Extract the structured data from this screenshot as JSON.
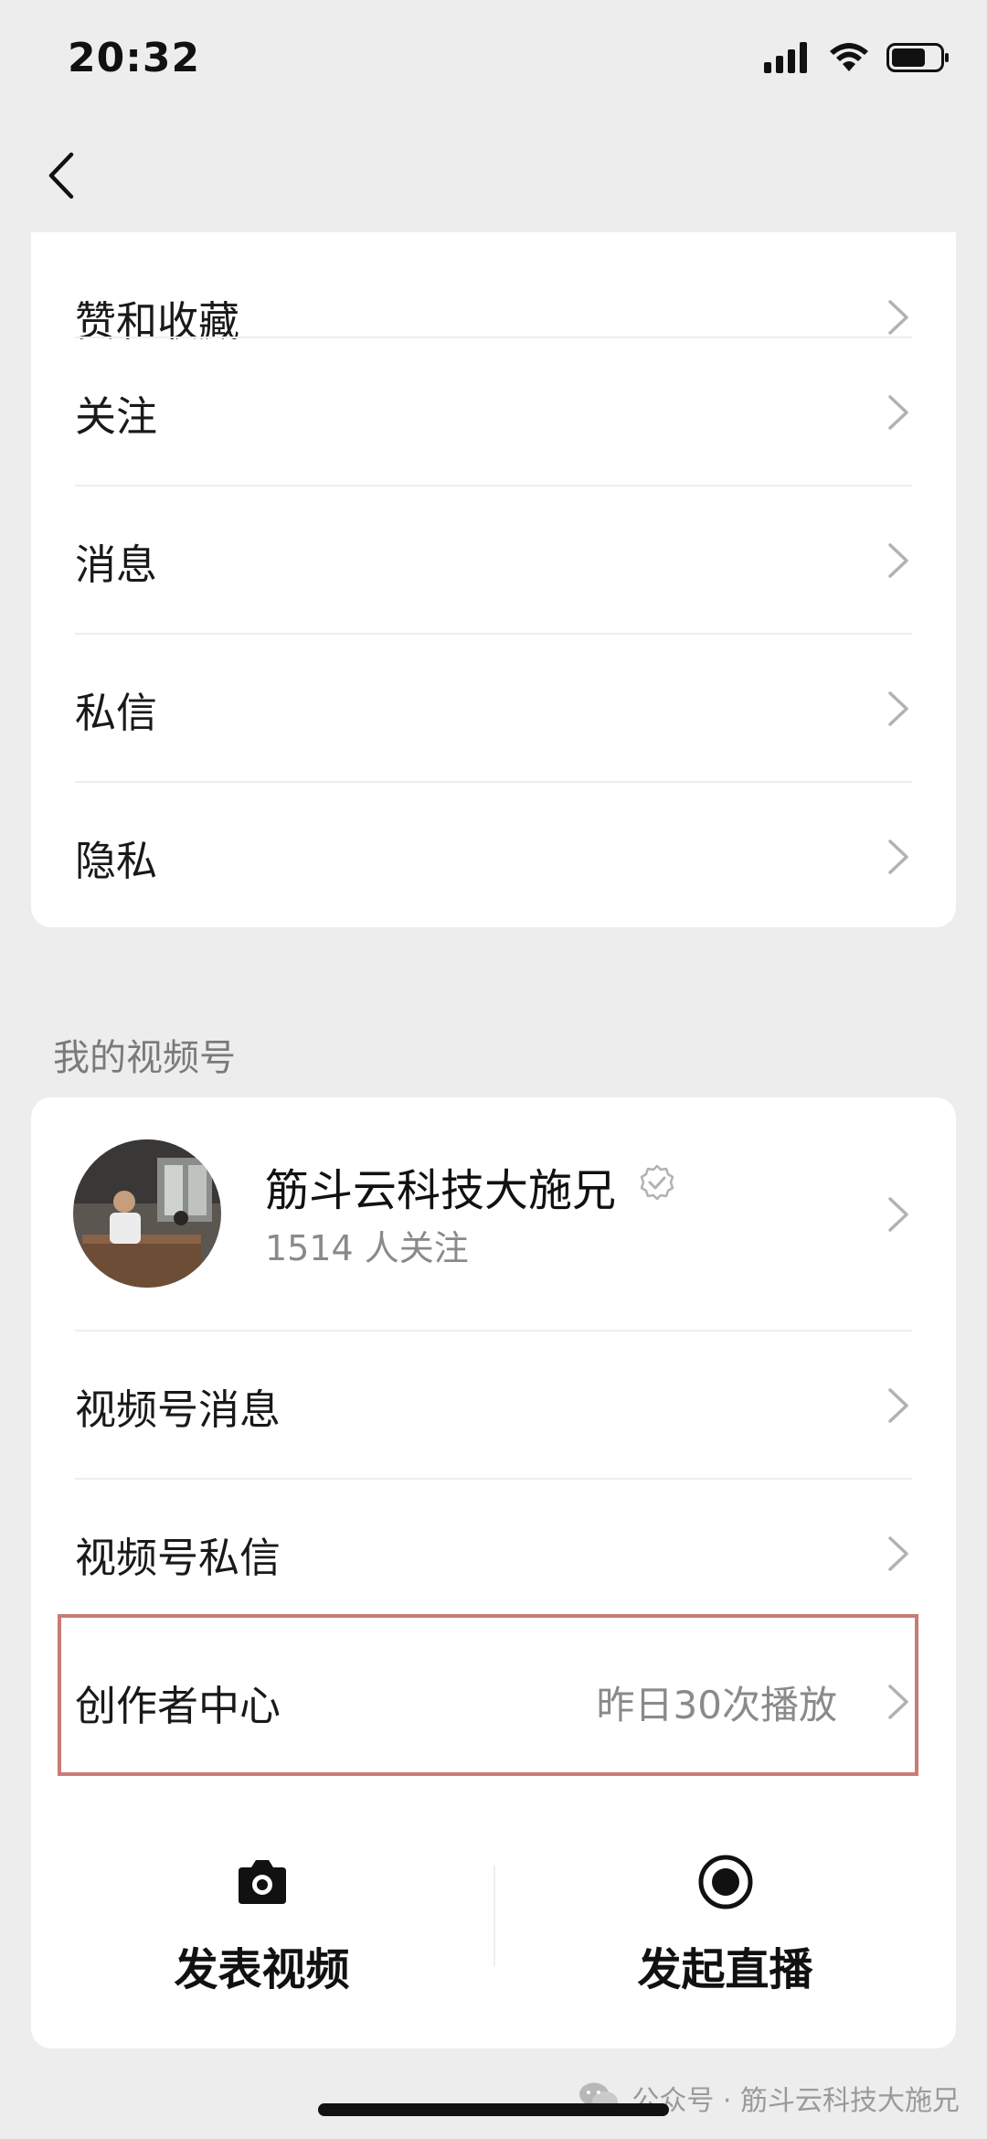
{
  "status_bar": {
    "time": "20:32",
    "battery_level": 0.7
  },
  "settings": {
    "items": [
      {
        "label": "赞和收藏"
      },
      {
        "label": "关注"
      },
      {
        "label": "消息"
      },
      {
        "label": "私信"
      },
      {
        "label": "隐私"
      }
    ]
  },
  "channels": {
    "section_title": "我的视频号",
    "profile": {
      "name": "筋斗云科技大施兄",
      "followers": "1514 人关注"
    },
    "items": [
      {
        "label": "视频号消息"
      },
      {
        "label": "视频号私信"
      },
      {
        "label": "创作者中心",
        "value": "昨日30次播放"
      }
    ],
    "actions": [
      {
        "label": "发表视频",
        "icon": "camera-icon"
      },
      {
        "label": "发起直播",
        "icon": "live-record-icon"
      }
    ]
  },
  "watermark": {
    "text": "公众号 · 筋斗云科技大施兄",
    "icon": "wechat-icon"
  },
  "colors": {
    "highlight": "#c97c76",
    "background": "#ededed"
  }
}
